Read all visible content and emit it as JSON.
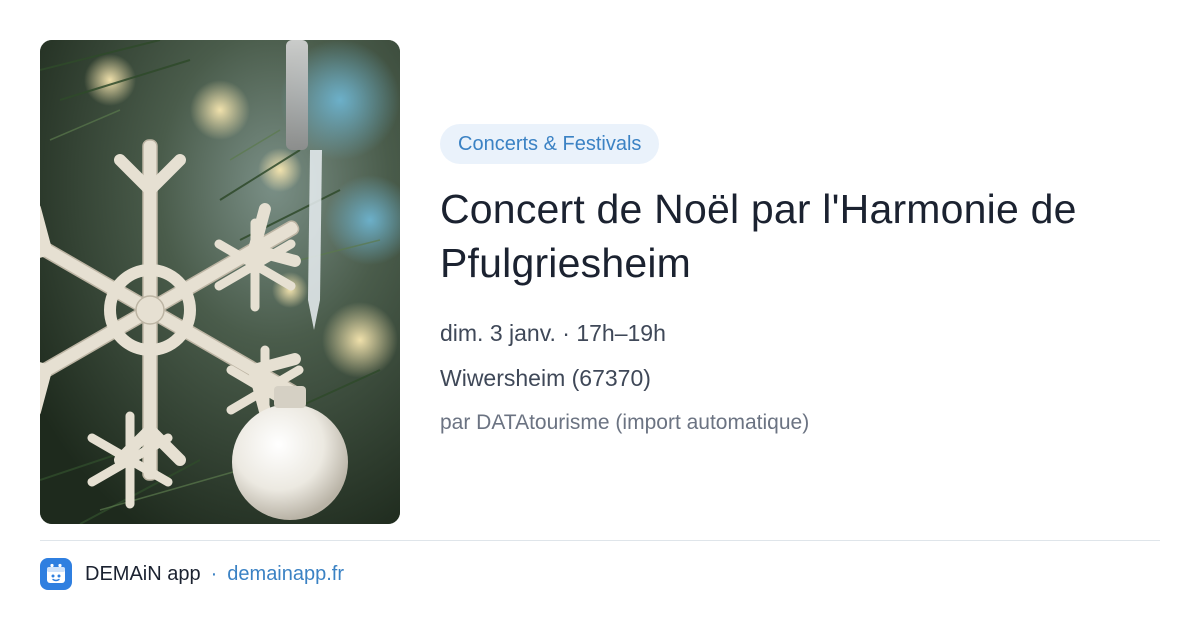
{
  "event": {
    "category": "Concerts & Festivals",
    "title": "Concert de Noël par l'Harmonie de Pfulgriesheim",
    "datetime": "dim. 3 janv. · 17h–19h",
    "location": "Wiwersheim (67370)",
    "source": "par DATAtourisme (import automatique)"
  },
  "image": {
    "subject": "snowflake-ornament-on-christmas-tree"
  },
  "footer": {
    "app_name": "DEMAiN app",
    "separator": "·",
    "url": "demainapp.fr",
    "icon": "demain-app-logo-icon"
  },
  "colors": {
    "accent": "#3b82c4",
    "badge_bg": "#eaf2fb",
    "title": "#1b2230",
    "app_icon": "#2f7fe0"
  }
}
